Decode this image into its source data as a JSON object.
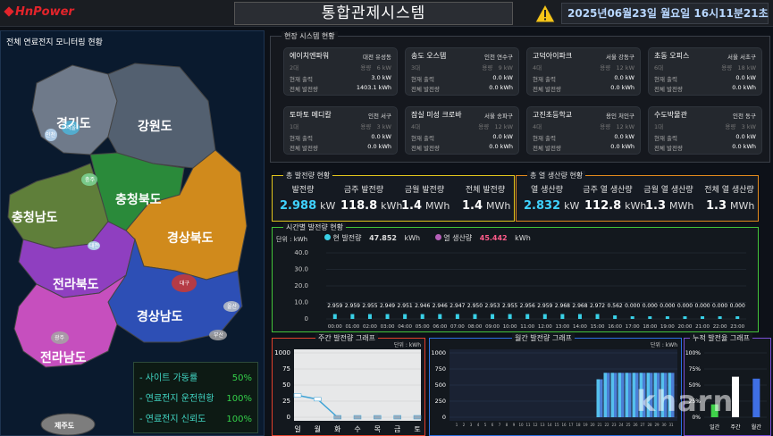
{
  "header": {
    "logo_text": "HnPower",
    "title": "통합관제시스템",
    "datetime": "2025년06월23일 월요일 16시11분21초"
  },
  "left": {
    "title": "전체 연료전지 모니터링 현황",
    "regions": [
      "경기도",
      "강원도",
      "충청북도",
      "충청남도",
      "경상북도",
      "전라북도",
      "경상남도",
      "전라남도",
      "제주도"
    ],
    "markers": [
      "서울",
      "인천",
      "충주",
      "대전",
      "대구",
      "울산",
      "광주",
      "부산"
    ],
    "status": [
      {
        "label": "- 사이트 가동률",
        "value": "50%"
      },
      {
        "label": "- 연료전지 운전현황",
        "value": "100%"
      },
      {
        "label": "- 연료전지 신뢰도",
        "value": "100%"
      }
    ]
  },
  "sites": {
    "title": "현장 시스템 현황",
    "labels": {
      "output": "현재 출력",
      "total": "전체 발전량",
      "cap": "용량"
    },
    "cards": [
      {
        "name": "에이치엔파워",
        "loc": "대전 유성동",
        "units": "2대",
        "cap": "6 kW",
        "output": "3.0 kW",
        "total": "1403.1 kWh"
      },
      {
        "name": "송도 오스템",
        "loc": "인천 연수구",
        "units": "3대",
        "cap": "9 kW",
        "output": "0.0 kW",
        "total": "0.0 kWh"
      },
      {
        "name": "고덕아이파크",
        "loc": "서울 강동구",
        "units": "4대",
        "cap": "12 kW",
        "output": "0.0 kW",
        "total": "0.0 kWh"
      },
      {
        "name": "초동 오피스",
        "loc": "서울 서초구",
        "units": "6대",
        "cap": "18 kW",
        "output": "0.0 kW",
        "total": "0.0 kWh"
      },
      {
        "name": "토마토 메디칼",
        "loc": "인천 서구",
        "units": "1대",
        "cap": "3 kW",
        "output": "0.0 kW",
        "total": "0.0 kWh"
      },
      {
        "name": "잠실 미성 크로바",
        "loc": "서울 송파구",
        "units": "4대",
        "cap": "12 kW",
        "output": "0.0 kW",
        "total": "0.0 kWh"
      },
      {
        "name": "고진초등학교",
        "loc": "용인 처인구",
        "units": "4대",
        "cap": "12 kW",
        "output": "0.0 kW",
        "total": "0.0 kWh"
      },
      {
        "name": "수도박물관",
        "loc": "인천 동구",
        "units": "1대",
        "cap": "3 kW",
        "output": "0.0 kW",
        "total": "0.0 kWh"
      }
    ]
  },
  "power": {
    "title": "총 발전량 현황",
    "items": [
      {
        "label": "발전량",
        "value": "2.988",
        "unit": "kW"
      },
      {
        "label": "금주 발전량",
        "value": "118.8",
        "unit": "kWh"
      },
      {
        "label": "금월 발전량",
        "value": "1.4",
        "unit": "MWh"
      },
      {
        "label": "전체 발전량",
        "value": "1.4",
        "unit": "MWh"
      }
    ]
  },
  "heat": {
    "title": "총 열 생산량 현황",
    "items": [
      {
        "label": "열 생산량",
        "value": "2.832",
        "unit": "kW"
      },
      {
        "label": "금주 열 생산량",
        "value": "112.8",
        "unit": "kWh"
      },
      {
        "label": "금월 열 생산량",
        "value": "1.3",
        "unit": "MWh"
      },
      {
        "label": "전체 열 생산량",
        "value": "1.3",
        "unit": "MWh"
      }
    ]
  },
  "hourly": {
    "title": "시간별 발전량 현황",
    "unit_label": "단위 : kWh",
    "legend_power": "현 발전량",
    "legend_power_value": "47.852",
    "legend_heat": "열 생산량",
    "legend_heat_value": "45.442",
    "legend_unit": "kWh"
  },
  "weekly": {
    "title": "주간 발전량 그래프",
    "unit_label": "단위 : kWh"
  },
  "monthly": {
    "title": "월간 발전량 그래프",
    "unit_label": "단위 : kWh"
  },
  "cumulative": {
    "title": "누적 발전율 그래프"
  },
  "watermark": "kharn",
  "chart_data": [
    {
      "type": "bar",
      "title": "시간별 발전량 현황",
      "categories": [
        "00:00",
        "01:00",
        "02:00",
        "03:00",
        "04:00",
        "05:00",
        "06:00",
        "07:00",
        "08:00",
        "09:00",
        "10:00",
        "11:00",
        "12:00",
        "13:00",
        "14:00",
        "15:00",
        "16:00",
        "17:00",
        "18:00",
        "19:00",
        "20:00",
        "21:00",
        "22:00",
        "23:00"
      ],
      "values": [
        2.959,
        2.959,
        2.955,
        2.949,
        2.951,
        2.946,
        2.946,
        2.947,
        2.95,
        2.953,
        2.955,
        2.956,
        2.959,
        2.968,
        2.968,
        2.972,
        0.562,
        0.0,
        0.0,
        0.0,
        0.0,
        0.0,
        0.0,
        0.0
      ],
      "labels": [
        "2.959",
        "2.959",
        "2.955",
        "2.949",
        "2.951",
        "2.946",
        "2.946",
        "2.947",
        "2.950",
        "2.953",
        "2.955",
        "2.956",
        "2.959",
        "2.968",
        "2.968",
        "2.972",
        "0.562",
        "0.000",
        "0.000",
        "0.000",
        "0.000",
        "0.000",
        "0.000",
        "0.000"
      ],
      "yticks": [
        "40.0",
        "30.0",
        "20.0",
        "10.0",
        "0"
      ],
      "ylim": [
        0,
        40
      ]
    },
    {
      "type": "line",
      "title": "주간 발전량 그래프",
      "categories": [
        "일",
        "월",
        "화",
        "수",
        "목",
        "금",
        "토"
      ],
      "values": [
        34,
        28,
        0,
        0,
        0,
        0,
        0
      ],
      "yticks": [
        "1000",
        "75",
        "50",
        "25",
        "0"
      ],
      "ylim": [
        0,
        100
      ]
    },
    {
      "type": "bar",
      "title": "월간 발전량 그래프",
      "categories": [
        "1",
        "2",
        "3",
        "4",
        "5",
        "6",
        "7",
        "8",
        "9",
        "10",
        "11",
        "12",
        "13",
        "14",
        "15",
        "16",
        "17",
        "18",
        "19",
        "20",
        "21",
        "22",
        "23",
        "24",
        "25",
        "26",
        "27",
        "28",
        "29",
        "30",
        "31"
      ],
      "values": [
        0,
        0,
        0,
        0,
        0,
        0,
        0,
        0,
        0,
        0,
        0,
        0,
        0,
        0,
        0,
        0,
        0,
        0,
        0,
        0,
        590,
        690,
        690,
        690,
        690,
        690,
        690,
        690,
        690,
        690,
        690
      ],
      "yticks": [
        "1000",
        "750",
        "500",
        "250",
        "0"
      ],
      "ylim": [
        0,
        1000
      ]
    },
    {
      "type": "bar",
      "title": "누적 발전율 그래프",
      "categories": [
        "일간",
        "주간",
        "월간"
      ],
      "values": [
        20,
        63,
        60
      ],
      "yticks": [
        "100%",
        "75%",
        "50%",
        "25%",
        "0%"
      ],
      "ylim": [
        0,
        100
      ]
    }
  ]
}
